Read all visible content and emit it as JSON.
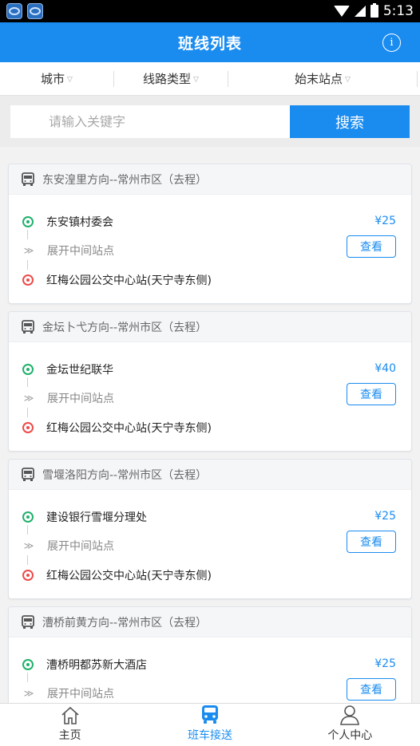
{
  "status_bar": {
    "time": "5:13"
  },
  "header": {
    "title": "班线列表",
    "info_icon": "info-icon"
  },
  "filters": [
    {
      "label": "城市"
    },
    {
      "label": "线路类型"
    },
    {
      "label": "始末站点"
    }
  ],
  "search": {
    "placeholder": "请输入关键字",
    "button_label": "搜索"
  },
  "routes": [
    {
      "title": "东安湟里方向--常州市区（去程）",
      "start": "东安镇村委会",
      "price": "¥25",
      "middle_label": "展开中间站点",
      "end": "红梅公园公交中心站(天宁寺东侧)",
      "view_label": "查看"
    },
    {
      "title": "金坛卜弋方向--常州市区（去程）",
      "start": "金坛世纪联华",
      "price": "¥40",
      "middle_label": "展开中间站点",
      "end": "红梅公园公交中心站(天宁寺东侧)",
      "view_label": "查看"
    },
    {
      "title": "雪堰洛阳方向--常州市区（去程）",
      "start": "建设银行雪堰分理处",
      "price": "¥25",
      "middle_label": "展开中间站点",
      "end": "红梅公园公交中心站(天宁寺东侧)",
      "view_label": "查看"
    },
    {
      "title": "漕桥前黄方向--常州市区（去程）",
      "start": "漕桥明都苏新大酒店",
      "price": "¥25",
      "middle_label": "展开中间站点",
      "end": "",
      "view_label": "查看"
    }
  ],
  "tabs": [
    {
      "label": "主页",
      "icon": "home-icon"
    },
    {
      "label": "班车接送",
      "icon": "bus-icon",
      "active": true
    },
    {
      "label": "个人中心",
      "icon": "user-icon"
    }
  ],
  "colors": {
    "primary": "#1a8cf0",
    "start_dot": "#1fb16b",
    "end_dot": "#ef4a4a"
  }
}
